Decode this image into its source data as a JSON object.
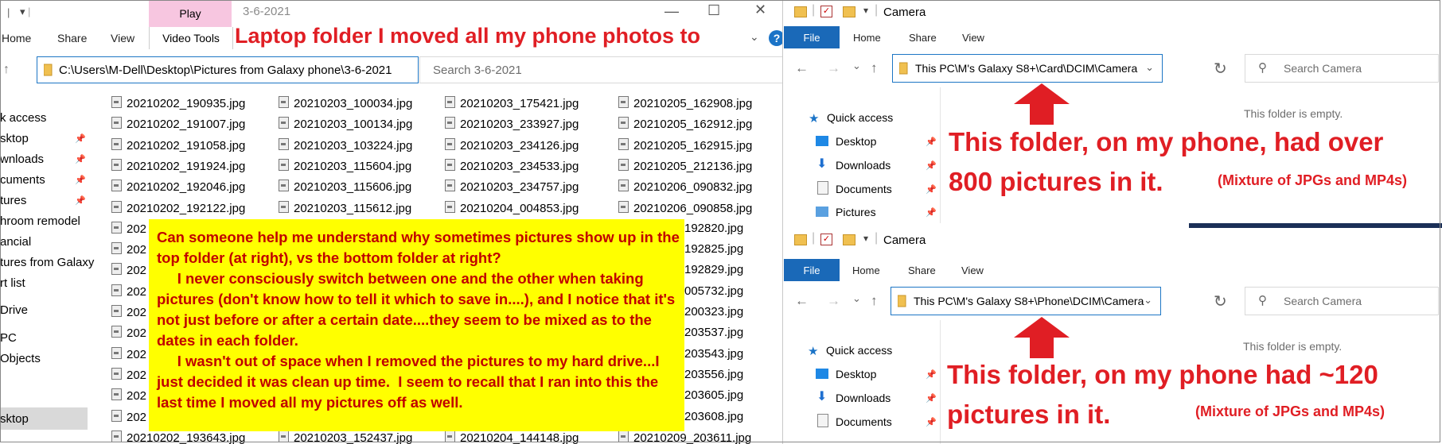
{
  "left_window": {
    "play_tab": "Play",
    "title": "3-6-2021",
    "ribbon_tabs": [
      "Home",
      "Share",
      "View"
    ],
    "video_tools": "Video Tools",
    "annotation_title": "Laptop folder I moved all my phone photos to",
    "address": "C:\\Users\\M-Dell\\Desktop\\Pictures from Galaxy phone\\3-6-2021",
    "search_placeholder": "Search 3-6-2021",
    "sidebar": [
      "k access",
      "sktop",
      "wnloads",
      "cuments",
      "tures",
      "hroom remodel",
      "ancial",
      "tures from Galaxy",
      "rt list",
      "Drive",
      "PC",
      "Objects",
      "sktop"
    ],
    "files": {
      "col1": [
        "20210202_190935.jpg",
        "20210202_191007.jpg",
        "20210202_191058.jpg",
        "20210202_191924.jpg",
        "20210202_192046.jpg",
        "20210202_192122.jpg",
        "202",
        "202",
        "202",
        "202",
        "202",
        "202",
        "202",
        "202",
        "202",
        "202",
        "20210202_193643.jpg"
      ],
      "col2": [
        "20210203_100034.jpg",
        "20210203_100134.jpg",
        "20210203_103224.jpg",
        "20210203_115604.jpg",
        "20210203_115606.jpg",
        "20210203_115612.jpg",
        "20210203_152437.jpg"
      ],
      "col3": [
        "20210203_175421.jpg",
        "20210203_233927.jpg",
        "20210203_234126.jpg",
        "20210203_234533.jpg",
        "20210203_234757.jpg",
        "20210204_004853.jpg",
        "20210204_144148.jpg"
      ],
      "col4": [
        "20210205_162908.jpg",
        "20210205_162912.jpg",
        "20210205_162915.jpg",
        "20210205_212136.jpg",
        "20210206_090832.jpg",
        "20210206_090858.jpg",
        "192820.jpg",
        "192825.jpg",
        "192829.jpg",
        "005732.jpg",
        "200323.jpg",
        "203537.jpg",
        "203543.jpg",
        "203556.jpg",
        "203605.jpg",
        "203608.jpg",
        "20210209_203611.jpg"
      ]
    },
    "note_text": "Can someone help me understand why sometimes pictures show up in the top folder (at right), vs the bottom folder at right?\n     I never consciously switch between one and the other when taking pictures (don't know how to tell it which to save in....), and I notice that it's not just before or after a certain date....they seem to be mixed as to the dates in each folder.\n     I wasn't out of space when I removed the pictures to my hard drive...I just decided it was clean up time.  I seem to recall that I ran into this the last time I moved all my pictures off as well."
  },
  "top_right": {
    "title": "Camera",
    "file_tab": "File",
    "tabs": [
      "Home",
      "Share",
      "View"
    ],
    "address": "This PC\\M's Galaxy S8+\\Card\\DCIM\\Camera",
    "search_placeholder": "Search Camera",
    "nav": [
      "Quick access",
      "Desktop",
      "Downloads",
      "Documents",
      "Pictures"
    ],
    "empty_text": "This folder is empty.",
    "annotation_line1": "This folder, on my phone, had over",
    "annotation_line2": "800 pictures in it.",
    "annotation_small": "(Mixture of JPGs and MP4s)"
  },
  "bottom_right": {
    "title": "Camera",
    "file_tab": "File",
    "tabs": [
      "Home",
      "Share",
      "View"
    ],
    "address": "This PC\\M's Galaxy S8+\\Phone\\DCIM\\Camera",
    "search_placeholder": "Search Camera",
    "nav": [
      "Quick access",
      "Desktop",
      "Downloads",
      "Documents"
    ],
    "empty_text": "This folder is empty.",
    "annotation_line1": "This folder, on my phone had ~120",
    "annotation_line2": "pictures in it.",
    "annotation_small": "(Mixture of JPGs and MP4s)"
  },
  "colors": {
    "annotation_red": "#e01e24",
    "note_yellow": "#ffff00",
    "note_text": "#c00000",
    "file_tab_blue": "#1a69b8",
    "play_pink": "#f7c6e0"
  }
}
